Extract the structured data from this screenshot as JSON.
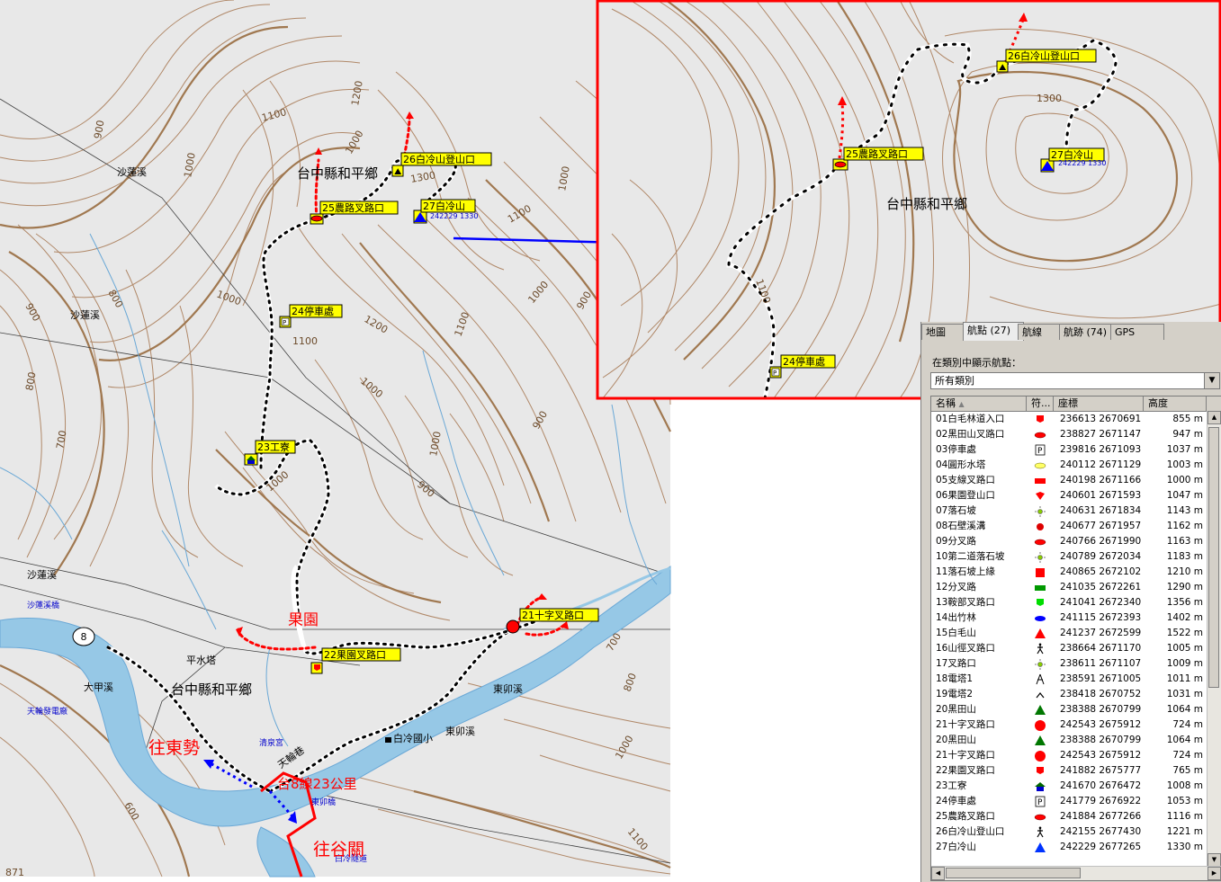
{
  "map": {
    "township_labels": [
      "台中縣和平鄉",
      "台中縣和平鄉",
      "台中縣和平鄉"
    ],
    "streams": [
      "沙蓮溪",
      "沙蓮溪",
      "沙蓮溪",
      "大甲溪",
      "東卯溪",
      "東卯溪"
    ],
    "places": [
      "天輪發電廠",
      "平水塔",
      "清泉宮",
      "白冷國小",
      "天輪巷",
      "東卯橋",
      "白冷隧道",
      "沙蓮溪橋"
    ],
    "directions": {
      "fruit_orchard": "果園",
      "to_dongshi": "往東勢",
      "to_guguan": "往谷關",
      "route_km": "台8線23公里"
    },
    "road_shield": "8",
    "contours": [
      "1100",
      "1200",
      "900",
      "1000",
      "1000",
      "1300",
      "1000",
      "1100",
      "900",
      "800",
      "1000",
      "1200",
      "1100",
      "1100",
      "1000",
      "900",
      "800",
      "700",
      "900",
      "1000",
      "1000",
      "900",
      "700",
      "800",
      "1000",
      "1100",
      "600",
      "871"
    ],
    "waypoints": {
      "wp21": "21十字叉路口",
      "wp22": "22果園叉路口",
      "wp23": "23工寮",
      "wp24": "24停車處",
      "wp25": "25農路叉路口",
      "wp26": "26白冷山登山口",
      "wp27": "27白冷山"
    },
    "peak_sub": "242229 1330",
    "inset": {
      "wp24": "24停車處",
      "wp25": "25農路叉路口",
      "wp26": "26白冷山登山口",
      "wp27": "27白冷山",
      "township": "台中縣和平鄉",
      "contours": [
        "1100",
        "1300"
      ],
      "peak_sub": "242229 1330"
    },
    "colors": {
      "frame": "#ff0000",
      "arrow": "#0000ff",
      "trail_red": "#ff0000",
      "contour": "#a07850",
      "river": "#96c8e6"
    }
  },
  "panel": {
    "tabs": [
      "地圖",
      "航點 (27)",
      "航線",
      "航跡 (74)",
      "GPS"
    ],
    "active_tab": 1,
    "filter_label": "在類別中顯示航點：",
    "filter_value": "所有類別",
    "columns": [
      "名稱",
      "符...",
      "座標",
      "高度"
    ],
    "rows": [
      {
        "name": "01白毛林道入口",
        "sym": "flag-red",
        "coord": "236613 2670691",
        "alt": "855 m"
      },
      {
        "name": "02黑田山叉路口",
        "sym": "ellipse-red",
        "coord": "238827 2671147",
        "alt": "947 m"
      },
      {
        "name": "03停車處",
        "sym": "parking",
        "coord": "239816 2671093",
        "alt": "1037 m"
      },
      {
        "name": "04圓形水塔",
        "sym": "ellipse-yellow",
        "coord": "240112 2671129",
        "alt": "1003 m"
      },
      {
        "name": "05支線叉路口",
        "sym": "rect-red",
        "coord": "240198 2671166",
        "alt": "1000 m"
      },
      {
        "name": "06果園登山口",
        "sym": "diamond-red",
        "coord": "240601 2671593",
        "alt": "1047 m"
      },
      {
        "name": "07落石坡",
        "sym": "light-green",
        "coord": "240631 2671834",
        "alt": "1143 m"
      },
      {
        "name": "08石壁溪溝",
        "sym": "dot-red",
        "coord": "240677 2671957",
        "alt": "1162 m"
      },
      {
        "name": "09分叉路",
        "sym": "ellipse-red",
        "coord": "240766 2671990",
        "alt": "1163 m"
      },
      {
        "name": "10第二道落石坡",
        "sym": "light-green",
        "coord": "240789 2672034",
        "alt": "1183 m"
      },
      {
        "name": "11落石坡上緣",
        "sym": "square-red",
        "coord": "240865 2672102",
        "alt": "1210 m"
      },
      {
        "name": "12分叉路",
        "sym": "rect-green",
        "coord": "241035 2672261",
        "alt": "1290 m"
      },
      {
        "name": "13鞍部叉路口",
        "sym": "flag-green",
        "coord": "241041 2672340",
        "alt": "1356 m"
      },
      {
        "name": "14出竹林",
        "sym": "ellipse-blue",
        "coord": "241115 2672393",
        "alt": "1402 m"
      },
      {
        "name": "15白毛山",
        "sym": "triangle-red",
        "coord": "241237 2672599",
        "alt": "1522 m"
      },
      {
        "name": "16山徑叉路口",
        "sym": "hiker",
        "coord": "238664 2671170",
        "alt": "1005 m"
      },
      {
        "name": "17叉路口",
        "sym": "light-green",
        "coord": "238611 2671107",
        "alt": "1009 m"
      },
      {
        "name": "18電塔1",
        "sym": "tower",
        "coord": "238591 2671005",
        "alt": "1011 m"
      },
      {
        "name": "19電塔2",
        "sym": "caret",
        "coord": "238418 2670752",
        "alt": "1031 m"
      },
      {
        "name": "20黑田山",
        "sym": "triangle-green",
        "coord": "238388 2670799",
        "alt": "1064 m"
      },
      {
        "name": "21十字叉路口",
        "sym": "circle-red",
        "coord": "242543 2675912",
        "alt": "724 m"
      },
      {
        "name": "20黑田山",
        "sym": "triangle-green",
        "coord": "238388 2670799",
        "alt": "1064 m"
      },
      {
        "name": "21十字叉路口",
        "sym": "circle-red",
        "coord": "242543 2675912",
        "alt": "724 m"
      },
      {
        "name": "22果園叉路口",
        "sym": "flag-red",
        "coord": "241882 2675777",
        "alt": "765 m"
      },
      {
        "name": "23工寮",
        "sym": "house",
        "coord": "241670 2676472",
        "alt": "1008 m"
      },
      {
        "name": "24停車處",
        "sym": "parking",
        "coord": "241779 2676922",
        "alt": "1053 m"
      },
      {
        "name": "25農路叉路口",
        "sym": "ellipse-red",
        "coord": "241884 2677266",
        "alt": "1116 m"
      },
      {
        "name": "26白冷山登山口",
        "sym": "hiker",
        "coord": "242155 2677430",
        "alt": "1221 m"
      },
      {
        "name": "27白冷山",
        "sym": "triangle-blue",
        "coord": "242229 2677265",
        "alt": "1330 m"
      }
    ]
  }
}
